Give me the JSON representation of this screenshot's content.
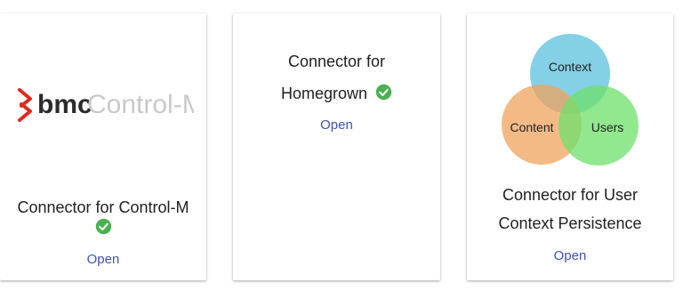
{
  "cards": [
    {
      "title_line1": "Connector for Control-M",
      "open_label": "Open",
      "logo": {
        "brand": "bmc",
        "product": "Control-M"
      }
    },
    {
      "title_line1": "Connector for",
      "title_line2": "Homegrown",
      "open_label": "Open"
    },
    {
      "title_line1": "Connector for User",
      "title_line2": "Context Persistence",
      "open_label": "Open",
      "venn": {
        "top": "Context",
        "left": "Content",
        "right": "Users"
      }
    }
  ],
  "icons": {
    "status_check": "check-circle-icon"
  },
  "colors": {
    "link": "#3f51b5",
    "check_green": "#4caf50",
    "bmc_red": "#e02a1c",
    "venn_context": "#5bc0de",
    "venn_content": "#f0a35e",
    "venn_users": "#6ee06a"
  }
}
